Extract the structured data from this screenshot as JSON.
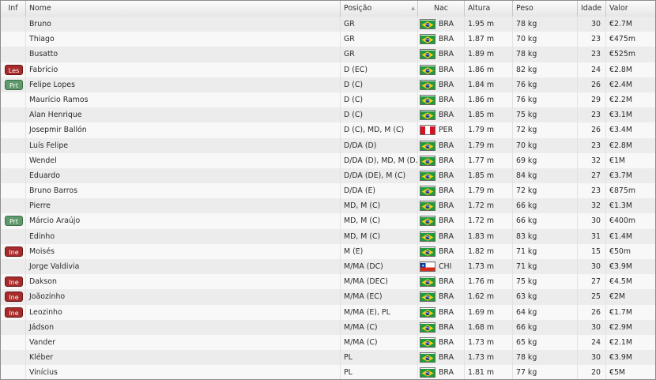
{
  "colors": {
    "badge_red": "#a72b2b",
    "badge_green": "#5e9a6b",
    "row_odd": "#ececec",
    "row_even": "#f8f8f8"
  },
  "headers": {
    "inf": "Inf",
    "nome": "Nome",
    "posicao": "Posição",
    "nac": "Nac",
    "altura": "Altura",
    "peso": "Peso",
    "idade": "Idade",
    "valor": "Valor"
  },
  "rows": [
    {
      "inf": "",
      "inf_type": "",
      "nome": "Bruno",
      "posicao": "GR",
      "flag": "brazil-flag-icon",
      "nac": "BRA",
      "altura": "1.95 m",
      "peso": "78 kg",
      "idade": "30",
      "valor": "€2.7M"
    },
    {
      "inf": "",
      "inf_type": "",
      "nome": "Thiago",
      "posicao": "GR",
      "flag": "brazil-flag-icon",
      "nac": "BRA",
      "altura": "1.87 m",
      "peso": "70 kg",
      "idade": "23",
      "valor": "€475m"
    },
    {
      "inf": "",
      "inf_type": "",
      "nome": "Busatto",
      "posicao": "GR",
      "flag": "brazil-flag-icon",
      "nac": "BRA",
      "altura": "1.89 m",
      "peso": "78 kg",
      "idade": "23",
      "valor": "€525m"
    },
    {
      "inf": "Les",
      "inf_type": "red",
      "nome": "Fabrício",
      "posicao": "D (EC)",
      "flag": "brazil-flag-icon",
      "nac": "BRA",
      "altura": "1.86 m",
      "peso": "82 kg",
      "idade": "24",
      "valor": "€2.8M"
    },
    {
      "inf": "Prt",
      "inf_type": "green",
      "nome": "Felipe Lopes",
      "posicao": "D (C)",
      "flag": "brazil-flag-icon",
      "nac": "BRA",
      "altura": "1.84 m",
      "peso": "76 kg",
      "idade": "26",
      "valor": "€2.4M"
    },
    {
      "inf": "",
      "inf_type": "",
      "nome": "Maurício Ramos",
      "posicao": "D (C)",
      "flag": "brazil-flag-icon",
      "nac": "BRA",
      "altura": "1.86 m",
      "peso": "76 kg",
      "idade": "29",
      "valor": "€2.2M"
    },
    {
      "inf": "",
      "inf_type": "",
      "nome": "Alan Henrique",
      "posicao": "D (C)",
      "flag": "brazil-flag-icon",
      "nac": "BRA",
      "altura": "1.85 m",
      "peso": "75 kg",
      "idade": "23",
      "valor": "€3.1M"
    },
    {
      "inf": "",
      "inf_type": "",
      "nome": "Josepmir Ballón",
      "posicao": "D (C), MD, M (C)",
      "flag": "peru-flag-icon",
      "nac": "PER",
      "altura": "1.79 m",
      "peso": "72 kg",
      "idade": "26",
      "valor": "€3.4M"
    },
    {
      "inf": "",
      "inf_type": "",
      "nome": "Luís Felipe",
      "posicao": "D/DA (D)",
      "flag": "brazil-flag-icon",
      "nac": "BRA",
      "altura": "1.79 m",
      "peso": "70 kg",
      "idade": "23",
      "valor": "€2.8M"
    },
    {
      "inf": "",
      "inf_type": "",
      "nome": "Wendel",
      "posicao": "D/DA (D), MD, M (D...",
      "flag": "brazil-flag-icon",
      "nac": "BRA",
      "altura": "1.77 m",
      "peso": "69 kg",
      "idade": "32",
      "valor": "€1M"
    },
    {
      "inf": "",
      "inf_type": "",
      "nome": "Eduardo",
      "posicao": "D/DA (DE), M (C)",
      "flag": "brazil-flag-icon",
      "nac": "BRA",
      "altura": "1.85 m",
      "peso": "84 kg",
      "idade": "27",
      "valor": "€3.7M"
    },
    {
      "inf": "",
      "inf_type": "",
      "nome": "Bruno Barros",
      "posicao": "D/DA (E)",
      "flag": "brazil-flag-icon",
      "nac": "BRA",
      "altura": "1.79 m",
      "peso": "72 kg",
      "idade": "23",
      "valor": "€875m"
    },
    {
      "inf": "",
      "inf_type": "",
      "nome": "Pierre",
      "posicao": "MD, M (C)",
      "flag": "brazil-flag-icon",
      "nac": "BRA",
      "altura": "1.72 m",
      "peso": "66 kg",
      "idade": "32",
      "valor": "€1.3M"
    },
    {
      "inf": "Prt",
      "inf_type": "green",
      "nome": "Márcio Araújo",
      "posicao": "MD, M (C)",
      "flag": "brazil-flag-icon",
      "nac": "BRA",
      "altura": "1.72 m",
      "peso": "66 kg",
      "idade": "30",
      "valor": "€400m"
    },
    {
      "inf": "",
      "inf_type": "",
      "nome": "Edinho",
      "posicao": "MD, M (C)",
      "flag": "brazil-flag-icon",
      "nac": "BRA",
      "altura": "1.83 m",
      "peso": "83 kg",
      "idade": "31",
      "valor": "€1.4M"
    },
    {
      "inf": "Ine",
      "inf_type": "red",
      "nome": "Moisés",
      "posicao": "M (E)",
      "flag": "brazil-flag-icon",
      "nac": "BRA",
      "altura": "1.82 m",
      "peso": "71 kg",
      "idade": "15",
      "valor": "€50m"
    },
    {
      "inf": "",
      "inf_type": "",
      "nome": "Jorge Valdivia",
      "posicao": "M/MA (DC)",
      "flag": "chile-flag-icon",
      "nac": "CHI",
      "altura": "1.73 m",
      "peso": "71 kg",
      "idade": "30",
      "valor": "€3.9M"
    },
    {
      "inf": "Ine",
      "inf_type": "red",
      "nome": "Dakson",
      "posicao": "M/MA (DEC)",
      "flag": "brazil-flag-icon",
      "nac": "BRA",
      "altura": "1.76 m",
      "peso": "75 kg",
      "idade": "27",
      "valor": "€4.5M"
    },
    {
      "inf": "Ine",
      "inf_type": "red",
      "nome": "Joãozinho",
      "posicao": "M/MA (EC)",
      "flag": "brazil-flag-icon",
      "nac": "BRA",
      "altura": "1.62 m",
      "peso": "63 kg",
      "idade": "25",
      "valor": "€2M"
    },
    {
      "inf": "Ine",
      "inf_type": "red",
      "nome": "Leozinho",
      "posicao": "M/MA (E), PL",
      "flag": "brazil-flag-icon",
      "nac": "BRA",
      "altura": "1.69 m",
      "peso": "64 kg",
      "idade": "26",
      "valor": "€1.7M"
    },
    {
      "inf": "",
      "inf_type": "",
      "nome": "Jádson",
      "posicao": "M/MA (C)",
      "flag": "brazil-flag-icon",
      "nac": "BRA",
      "altura": "1.68 m",
      "peso": "66 kg",
      "idade": "30",
      "valor": "€2.9M"
    },
    {
      "inf": "",
      "inf_type": "",
      "nome": "Vander",
      "posicao": "M/MA (C)",
      "flag": "brazil-flag-icon",
      "nac": "BRA",
      "altura": "1.73 m",
      "peso": "65 kg",
      "idade": "24",
      "valor": "€2.1M"
    },
    {
      "inf": "",
      "inf_type": "",
      "nome": "Kléber",
      "posicao": "PL",
      "flag": "brazil-flag-icon",
      "nac": "BRA",
      "altura": "1.73 m",
      "peso": "78 kg",
      "idade": "30",
      "valor": "€3.9M"
    },
    {
      "inf": "",
      "inf_type": "",
      "nome": "Vinícius",
      "posicao": "PL",
      "flag": "brazil-flag-icon",
      "nac": "BRA",
      "altura": "1.81 m",
      "peso": "77 kg",
      "idade": "20",
      "valor": "€5M"
    }
  ]
}
